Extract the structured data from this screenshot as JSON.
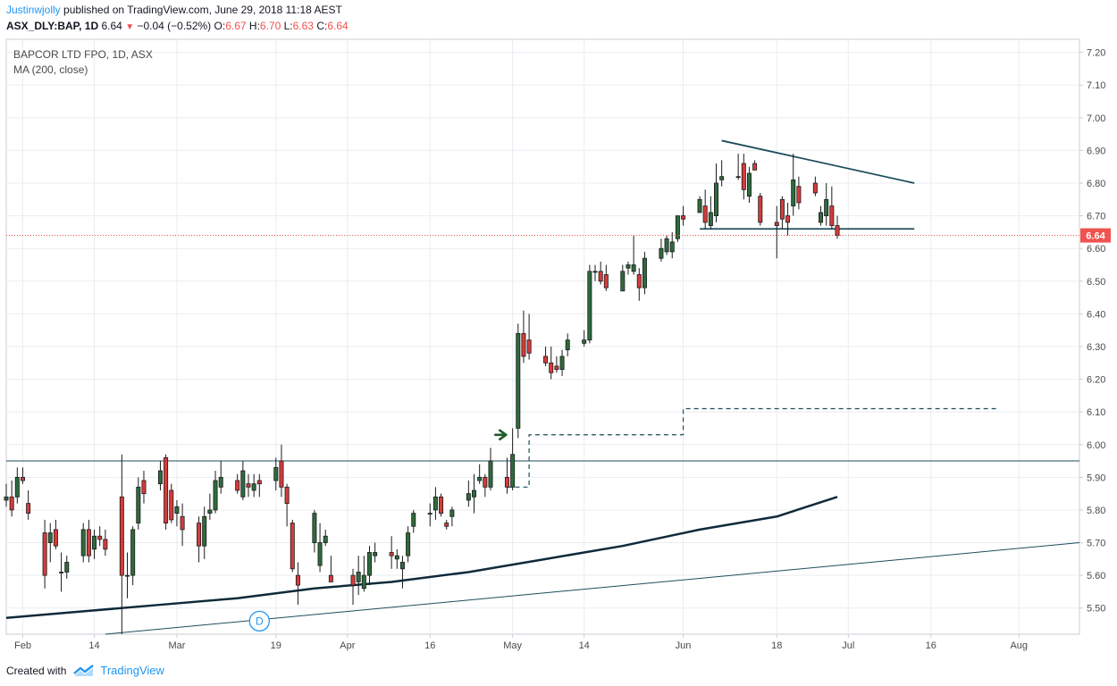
{
  "header": {
    "author": "Justinwjolly",
    "published_text": "published on TradingView.com, June 29, 2018 11:18 AEST",
    "symbol": "ASX_DLY:BAP, 1D",
    "last": "6.64",
    "change": "−0.04 (−0.52%)",
    "o_label": "O:",
    "o_value": "6.67",
    "h_label": "H:",
    "h_value": "6.70",
    "l_label": "L:",
    "l_value": "6.63",
    "c_label": "C:",
    "c_value": "6.64"
  },
  "legend": {
    "title": "BAPCOR LTD FPO, 1D, ASX",
    "ma": "MA (200, close)"
  },
  "footer": {
    "created_with": "Created with",
    "brand": "TradingView"
  },
  "colors": {
    "up": "#2e6b3d",
    "down": "#d63b3b",
    "ma": "#0f2a3a",
    "trend": "#1e4d5c",
    "price_line": "#ef5350",
    "grid": "#e9edf2",
    "axis_text": "#4a4a4a",
    "brand": "#2196f3"
  },
  "chart_data": {
    "type": "candlestick",
    "ylim": [
      5.42,
      7.24
    ],
    "y_ticks": [
      "5.50",
      "5.60",
      "5.70",
      "5.80",
      "5.90",
      "6.00",
      "6.10",
      "6.20",
      "6.30",
      "6.40",
      "6.50",
      "6.60",
      "6.70",
      "6.80",
      "6.90",
      "7.00",
      "7.10",
      "7.20"
    ],
    "x_ticks": [
      {
        "date": "2018-02-01",
        "label": "Feb"
      },
      {
        "date": "2018-02-14",
        "label": "14"
      },
      {
        "date": "2018-03-01",
        "label": "Mar"
      },
      {
        "date": "2018-03-19",
        "label": "19"
      },
      {
        "date": "2018-04-01",
        "label": "Apr"
      },
      {
        "date": "2018-04-16",
        "label": "16"
      },
      {
        "date": "2018-05-01",
        "label": "May"
      },
      {
        "date": "2018-05-14",
        "label": "14"
      },
      {
        "date": "2018-06-01",
        "label": "Jun"
      },
      {
        "date": "2018-06-18",
        "label": "18"
      },
      {
        "date": "2018-07-01",
        "label": "Jul"
      },
      {
        "date": "2018-07-16",
        "label": "16"
      },
      {
        "date": "2018-08-01",
        "label": "Aug"
      }
    ],
    "x_range": [
      "2018-01-29",
      "2018-08-12"
    ],
    "last_price_label": "6.64",
    "candles": [
      {
        "date": "2018-01-29",
        "o": 5.83,
        "h": 5.88,
        "l": 5.81,
        "c": 5.84
      },
      {
        "date": "2018-01-30",
        "o": 5.84,
        "h": 5.89,
        "l": 5.78,
        "c": 5.8
      },
      {
        "date": "2018-01-31",
        "o": 5.84,
        "h": 5.93,
        "l": 5.82,
        "c": 5.9
      },
      {
        "date": "2018-02-01",
        "o": 5.9,
        "h": 5.93,
        "l": 5.88,
        "c": 5.89
      },
      {
        "date": "2018-02-02",
        "o": 5.82,
        "h": 5.86,
        "l": 5.77,
        "c": 5.79
      },
      {
        "date": "2018-02-05",
        "o": 5.73,
        "h": 5.77,
        "l": 5.56,
        "c": 5.6
      },
      {
        "date": "2018-02-06",
        "o": 5.7,
        "h": 5.76,
        "l": 5.64,
        "c": 5.73
      },
      {
        "date": "2018-02-07",
        "o": 5.74,
        "h": 5.77,
        "l": 5.68,
        "c": 5.69
      },
      {
        "date": "2018-02-08",
        "o": 5.61,
        "h": 5.67,
        "l": 5.55,
        "c": 5.61
      },
      {
        "date": "2018-02-09",
        "o": 5.61,
        "h": 5.66,
        "l": 5.59,
        "c": 5.64
      },
      {
        "date": "2018-02-12",
        "o": 5.66,
        "h": 5.76,
        "l": 5.64,
        "c": 5.74
      },
      {
        "date": "2018-02-13",
        "o": 5.74,
        "h": 5.77,
        "l": 5.64,
        "c": 5.66
      },
      {
        "date": "2018-02-14",
        "o": 5.68,
        "h": 5.74,
        "l": 5.65,
        "c": 5.72
      },
      {
        "date": "2018-02-15",
        "o": 5.72,
        "h": 5.75,
        "l": 5.69,
        "c": 5.71
      },
      {
        "date": "2018-02-16",
        "o": 5.71,
        "h": 5.74,
        "l": 5.66,
        "c": 5.68
      },
      {
        "date": "2018-02-19",
        "o": 5.84,
        "h": 5.97,
        "l": 5.42,
        "c": 5.6
      },
      {
        "date": "2018-02-20",
        "o": 5.6,
        "h": 5.67,
        "l": 5.53,
        "c": 5.6
      },
      {
        "date": "2018-02-21",
        "o": 5.6,
        "h": 5.75,
        "l": 5.57,
        "c": 5.74
      },
      {
        "date": "2018-02-22",
        "o": 5.76,
        "h": 5.9,
        "l": 5.74,
        "c": 5.87
      },
      {
        "date": "2018-02-23",
        "o": 5.89,
        "h": 5.92,
        "l": 5.82,
        "c": 5.85
      },
      {
        "date": "2018-02-26",
        "o": 5.88,
        "h": 5.95,
        "l": 5.86,
        "c": 5.92
      },
      {
        "date": "2018-02-27",
        "o": 5.96,
        "h": 5.97,
        "l": 5.74,
        "c": 5.76
      },
      {
        "date": "2018-02-28",
        "o": 5.86,
        "h": 5.88,
        "l": 5.76,
        "c": 5.77
      },
      {
        "date": "2018-03-01",
        "o": 5.79,
        "h": 5.83,
        "l": 5.75,
        "c": 5.81
      },
      {
        "date": "2018-03-02",
        "o": 5.78,
        "h": 5.82,
        "l": 5.69,
        "c": 5.74
      },
      {
        "date": "2018-03-05",
        "o": 5.76,
        "h": 5.78,
        "l": 5.64,
        "c": 5.69
      },
      {
        "date": "2018-03-06",
        "o": 5.69,
        "h": 5.81,
        "l": 5.65,
        "c": 5.78
      },
      {
        "date": "2018-03-07",
        "o": 5.79,
        "h": 5.85,
        "l": 5.77,
        "c": 5.8
      },
      {
        "date": "2018-03-08",
        "o": 5.8,
        "h": 5.92,
        "l": 5.79,
        "c": 5.89
      },
      {
        "date": "2018-03-09",
        "o": 5.87,
        "h": 5.95,
        "l": 5.85,
        "c": 5.9
      },
      {
        "date": "2018-03-12",
        "o": 5.89,
        "h": 5.91,
        "l": 5.85,
        "c": 5.86
      },
      {
        "date": "2018-03-13",
        "o": 5.84,
        "h": 5.95,
        "l": 5.83,
        "c": 5.92
      },
      {
        "date": "2018-03-14",
        "o": 5.88,
        "h": 5.91,
        "l": 5.84,
        "c": 5.87
      },
      {
        "date": "2018-03-15",
        "o": 5.86,
        "h": 5.91,
        "l": 5.84,
        "c": 5.88
      },
      {
        "date": "2018-03-16",
        "o": 5.89,
        "h": 5.91,
        "l": 5.84,
        "c": 5.88
      },
      {
        "date": "2018-03-19",
        "o": 5.89,
        "h": 5.96,
        "l": 5.86,
        "c": 5.93
      },
      {
        "date": "2018-03-20",
        "o": 5.95,
        "h": 6.0,
        "l": 5.84,
        "c": 5.87
      },
      {
        "date": "2018-03-21",
        "o": 5.87,
        "h": 5.88,
        "l": 5.75,
        "c": 5.82
      },
      {
        "date": "2018-03-22",
        "o": 5.76,
        "h": 5.77,
        "l": 5.61,
        "c": 5.62
      },
      {
        "date": "2018-03-23",
        "o": 5.6,
        "h": 5.64,
        "l": 5.51,
        "c": 5.57
      },
      {
        "date": "2018-03-26",
        "o": 5.7,
        "h": 5.8,
        "l": 5.67,
        "c": 5.79
      },
      {
        "date": "2018-03-27",
        "o": 5.63,
        "h": 5.76,
        "l": 5.61,
        "c": 5.7
      },
      {
        "date": "2018-03-28",
        "o": 5.7,
        "h": 5.74,
        "l": 5.69,
        "c": 5.72
      },
      {
        "date": "2018-03-29",
        "o": 5.6,
        "h": 5.66,
        "l": 5.58,
        "c": 5.58
      },
      {
        "date": "2018-04-02",
        "o": 5.6,
        "h": 5.62,
        "l": 5.51,
        "c": 5.57
      },
      {
        "date": "2018-04-03",
        "o": 5.58,
        "h": 5.66,
        "l": 5.54,
        "c": 5.61
      },
      {
        "date": "2018-04-04",
        "o": 5.56,
        "h": 5.66,
        "l": 5.55,
        "c": 5.6
      },
      {
        "date": "2018-04-05",
        "o": 5.6,
        "h": 5.69,
        "l": 5.57,
        "c": 5.67
      },
      {
        "date": "2018-04-06",
        "o": 5.66,
        "h": 5.7,
        "l": 5.64,
        "c": 5.67
      },
      {
        "date": "2018-04-09",
        "o": 5.67,
        "h": 5.72,
        "l": 5.62,
        "c": 5.66
      },
      {
        "date": "2018-04-10",
        "o": 5.65,
        "h": 5.68,
        "l": 5.62,
        "c": 5.66
      },
      {
        "date": "2018-04-11",
        "o": 5.62,
        "h": 5.66,
        "l": 5.56,
        "c": 5.64
      },
      {
        "date": "2018-04-12",
        "o": 5.66,
        "h": 5.75,
        "l": 5.64,
        "c": 5.73
      },
      {
        "date": "2018-04-13",
        "o": 5.75,
        "h": 5.8,
        "l": 5.73,
        "c": 5.79
      },
      {
        "date": "2018-04-16",
        "o": 5.79,
        "h": 5.82,
        "l": 5.75,
        "c": 5.79
      },
      {
        "date": "2018-04-17",
        "o": 5.8,
        "h": 5.87,
        "l": 5.77,
        "c": 5.84
      },
      {
        "date": "2018-04-18",
        "o": 5.84,
        "h": 5.85,
        "l": 5.78,
        "c": 5.79
      },
      {
        "date": "2018-04-19",
        "o": 5.76,
        "h": 5.77,
        "l": 5.74,
        "c": 5.75
      },
      {
        "date": "2018-04-20",
        "o": 5.78,
        "h": 5.81,
        "l": 5.75,
        "c": 5.8
      },
      {
        "date": "2018-04-23",
        "o": 5.83,
        "h": 5.89,
        "l": 5.81,
        "c": 5.85
      },
      {
        "date": "2018-04-24",
        "o": 5.84,
        "h": 5.91,
        "l": 5.79,
        "c": 5.86
      },
      {
        "date": "2018-04-25",
        "o": 5.89,
        "h": 5.94,
        "l": 5.88,
        "c": 5.9
      },
      {
        "date": "2018-04-26",
        "o": 5.9,
        "h": 5.91,
        "l": 5.84,
        "c": 5.87
      },
      {
        "date": "2018-04-27",
        "o": 5.87,
        "h": 5.99,
        "l": 5.86,
        "c": 5.95
      },
      {
        "date": "2018-04-30",
        "o": 5.9,
        "h": 5.96,
        "l": 5.85,
        "c": 5.87
      },
      {
        "date": "2018-05-01",
        "o": 5.87,
        "h": 6.05,
        "l": 5.86,
        "c": 5.97
      },
      {
        "date": "2018-05-02",
        "o": 6.05,
        "h": 6.37,
        "l": 6.02,
        "c": 6.34
      },
      {
        "date": "2018-05-03",
        "o": 6.34,
        "h": 6.41,
        "l": 6.25,
        "c": 6.27
      },
      {
        "date": "2018-05-04",
        "o": 6.32,
        "h": 6.4,
        "l": 6.26,
        "c": 6.28
      },
      {
        "date": "2018-05-07",
        "o": 6.27,
        "h": 6.3,
        "l": 6.24,
        "c": 6.25
      },
      {
        "date": "2018-05-08",
        "o": 6.25,
        "h": 6.3,
        "l": 6.2,
        "c": 6.22
      },
      {
        "date": "2018-05-09",
        "o": 6.24,
        "h": 6.27,
        "l": 6.22,
        "c": 6.23
      },
      {
        "date": "2018-05-10",
        "o": 6.23,
        "h": 6.29,
        "l": 6.21,
        "c": 6.27
      },
      {
        "date": "2018-05-11",
        "o": 6.29,
        "h": 6.34,
        "l": 6.27,
        "c": 6.32
      },
      {
        "date": "2018-05-14",
        "o": 6.31,
        "h": 6.35,
        "l": 6.3,
        "c": 6.32
      },
      {
        "date": "2018-05-15",
        "o": 6.32,
        "h": 6.55,
        "l": 6.31,
        "c": 6.53
      },
      {
        "date": "2018-05-16",
        "o": 6.53,
        "h": 6.55,
        "l": 6.5,
        "c": 6.53
      },
      {
        "date": "2018-05-17",
        "o": 6.53,
        "h": 6.56,
        "l": 6.49,
        "c": 6.5
      },
      {
        "date": "2018-05-18",
        "o": 6.52,
        "h": 6.55,
        "l": 6.47,
        "c": 6.48
      },
      {
        "date": "2018-05-21",
        "o": 6.47,
        "h": 6.55,
        "l": 6.47,
        "c": 6.53
      },
      {
        "date": "2018-05-22",
        "o": 6.54,
        "h": 6.56,
        "l": 6.52,
        "c": 6.55
      },
      {
        "date": "2018-05-23",
        "o": 6.53,
        "h": 6.64,
        "l": 6.52,
        "c": 6.55
      },
      {
        "date": "2018-05-24",
        "o": 6.52,
        "h": 6.54,
        "l": 6.44,
        "c": 6.48
      },
      {
        "date": "2018-05-25",
        "o": 6.48,
        "h": 6.59,
        "l": 6.46,
        "c": 6.57
      },
      {
        "date": "2018-05-28",
        "o": 6.57,
        "h": 6.63,
        "l": 6.56,
        "c": 6.6
      },
      {
        "date": "2018-05-29",
        "o": 6.59,
        "h": 6.64,
        "l": 6.58,
        "c": 6.63
      },
      {
        "date": "2018-05-30",
        "o": 6.59,
        "h": 6.65,
        "l": 6.57,
        "c": 6.62
      },
      {
        "date": "2018-05-31",
        "o": 6.63,
        "h": 6.7,
        "l": 6.62,
        "c": 6.7
      },
      {
        "date": "2018-06-01",
        "o": 6.7,
        "h": 6.73,
        "l": 6.67,
        "c": 6.69
      },
      {
        "date": "2018-06-04",
        "o": 6.71,
        "h": 6.76,
        "l": 6.71,
        "c": 6.75
      },
      {
        "date": "2018-06-05",
        "o": 6.73,
        "h": 6.78,
        "l": 6.66,
        "c": 6.68
      },
      {
        "date": "2018-06-06",
        "o": 6.67,
        "h": 6.76,
        "l": 6.66,
        "c": 6.71
      },
      {
        "date": "2018-06-07",
        "o": 6.7,
        "h": 6.86,
        "l": 6.68,
        "c": 6.8
      },
      {
        "date": "2018-06-08",
        "o": 6.81,
        "h": 6.87,
        "l": 6.79,
        "c": 6.82
      },
      {
        "date": "2018-06-11",
        "o": 6.82,
        "h": 6.89,
        "l": 6.81,
        "c": 6.82
      },
      {
        "date": "2018-06-12",
        "o": 6.86,
        "h": 6.89,
        "l": 6.75,
        "c": 6.78
      },
      {
        "date": "2018-06-13",
        "o": 6.76,
        "h": 6.85,
        "l": 6.74,
        "c": 6.83
      },
      {
        "date": "2018-06-14",
        "o": 6.86,
        "h": 6.87,
        "l": 6.84,
        "c": 6.84
      },
      {
        "date": "2018-06-15",
        "o": 6.76,
        "h": 6.77,
        "l": 6.67,
        "c": 6.68
      },
      {
        "date": "2018-06-18",
        "o": 6.68,
        "h": 6.73,
        "l": 6.57,
        "c": 6.67
      },
      {
        "date": "2018-06-19",
        "o": 6.75,
        "h": 6.76,
        "l": 6.66,
        "c": 6.69
      },
      {
        "date": "2018-06-20",
        "o": 6.7,
        "h": 6.74,
        "l": 6.64,
        "c": 6.68
      },
      {
        "date": "2018-06-21",
        "o": 6.73,
        "h": 6.89,
        "l": 6.7,
        "c": 6.81
      },
      {
        "date": "2018-06-22",
        "o": 6.79,
        "h": 6.82,
        "l": 6.72,
        "c": 6.74
      },
      {
        "date": "2018-06-25",
        "o": 6.8,
        "h": 6.82,
        "l": 6.76,
        "c": 6.77
      },
      {
        "date": "2018-06-26",
        "o": 6.68,
        "h": 6.73,
        "l": 6.67,
        "c": 6.71
      },
      {
        "date": "2018-06-27",
        "o": 6.7,
        "h": 6.8,
        "l": 6.67,
        "c": 6.75
      },
      {
        "date": "2018-06-28",
        "o": 6.73,
        "h": 6.79,
        "l": 6.66,
        "c": 6.67
      },
      {
        "date": "2018-06-29",
        "o": 6.67,
        "h": 6.7,
        "l": 6.63,
        "c": 6.64
      }
    ],
    "ma200": [
      {
        "date": "2018-01-29",
        "v": 5.47
      },
      {
        "date": "2018-02-12",
        "v": 5.49
      },
      {
        "date": "2018-02-26",
        "v": 5.51
      },
      {
        "date": "2018-03-12",
        "v": 5.53
      },
      {
        "date": "2018-03-26",
        "v": 5.56
      },
      {
        "date": "2018-04-09",
        "v": 5.58
      },
      {
        "date": "2018-04-23",
        "v": 5.61
      },
      {
        "date": "2018-05-07",
        "v": 5.65
      },
      {
        "date": "2018-05-21",
        "v": 5.69
      },
      {
        "date": "2018-06-04",
        "v": 5.74
      },
      {
        "date": "2018-06-18",
        "v": 5.78
      },
      {
        "date": "2018-06-29",
        "v": 5.84
      }
    ],
    "drawings": {
      "horizontal_line": 5.95,
      "rising_trendline": [
        {
          "date": "2018-02-16",
          "v": 5.42
        },
        {
          "date": "2018-08-12",
          "v": 5.7
        }
      ],
      "descending_trendline": [
        {
          "date": "2018-06-08",
          "v": 6.93
        },
        {
          "date": "2018-07-13",
          "v": 6.8
        }
      ],
      "support_line": [
        {
          "date": "2018-06-04",
          "v": 6.66
        },
        {
          "date": "2018-07-13",
          "v": 6.66
        }
      ],
      "dashed_step": [
        {
          "date": "2018-04-30",
          "v": 5.87
        },
        {
          "date": "2018-05-04",
          "v": 5.87
        },
        {
          "date": "2018-05-04",
          "v": 6.03
        },
        {
          "date": "2018-06-01",
          "v": 6.03
        },
        {
          "date": "2018-06-01",
          "v": 6.11
        },
        {
          "date": "2018-07-28",
          "v": 6.11
        }
      ],
      "arrow": {
        "date": "2018-04-29",
        "v": 6.03
      },
      "event_marker": {
        "date": "2018-03-16",
        "v": 5.46,
        "label": "D"
      }
    }
  }
}
